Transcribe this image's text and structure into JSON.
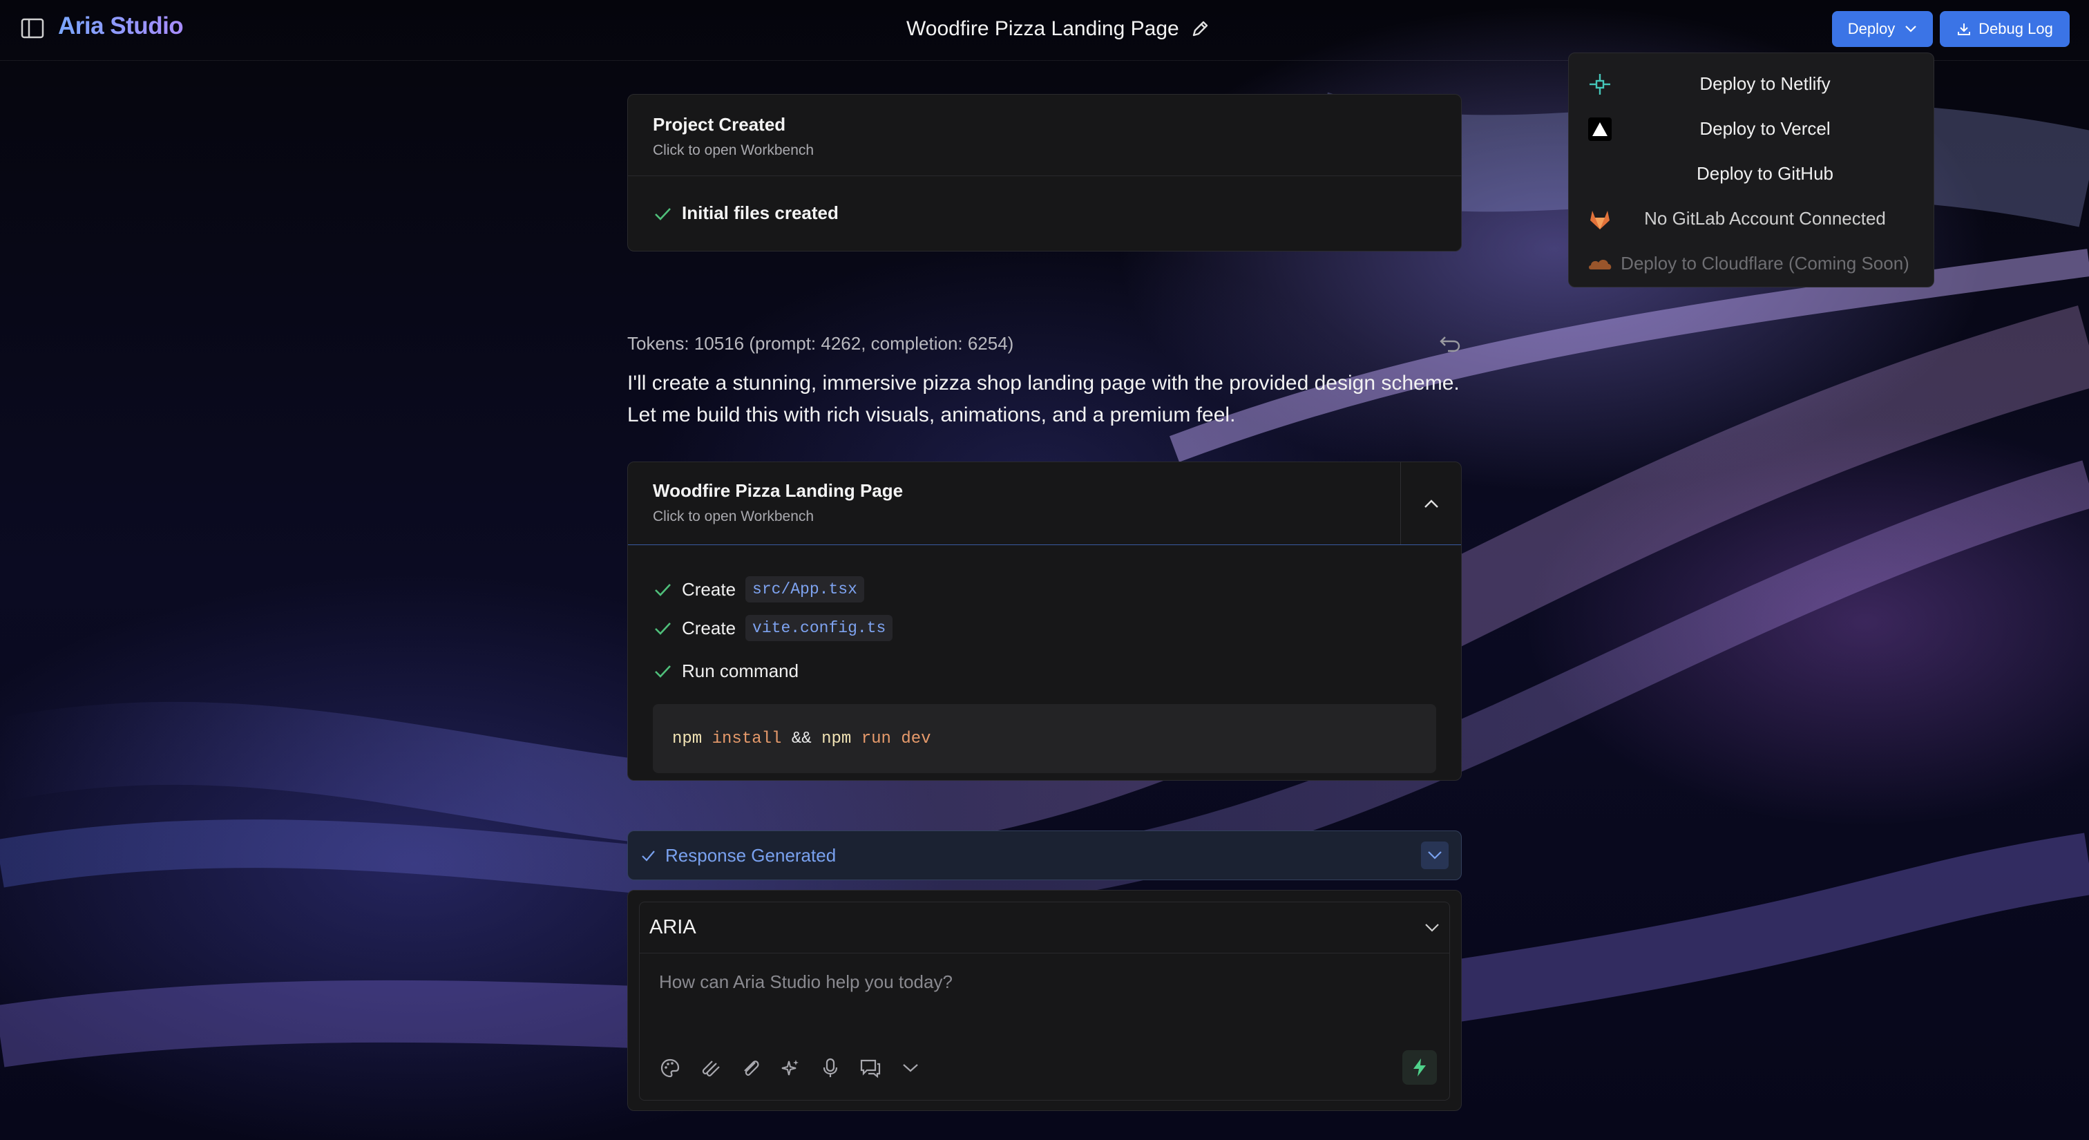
{
  "app": {
    "brand": "Aria Studio"
  },
  "header": {
    "project_title": "Woodfire Pizza Landing Page",
    "deploy_label": "Deploy",
    "debug_label": "Debug Log"
  },
  "deploy_menu": {
    "items": [
      {
        "label": "Deploy to Netlify",
        "icon": "netlify-icon"
      },
      {
        "label": "Deploy to Vercel",
        "icon": "vercel-icon"
      },
      {
        "label": "Deploy to GitHub",
        "icon": ""
      },
      {
        "label": "No GitLab Account Connected",
        "icon": "gitlab-icon"
      },
      {
        "label": "Deploy to Cloudflare (Coming Soon)",
        "icon": "cloudflare-icon"
      }
    ]
  },
  "card_project_created": {
    "title": "Project Created",
    "subtitle": "Click to open Workbench",
    "status": "Initial files created"
  },
  "tokens_text": "Tokens: 10516 (prompt: 4262, completion: 6254)",
  "assistant_message": "I'll create a stunning, immersive pizza shop landing page with the provided design scheme. Let me build this with rich visuals, animations, and a premium feel.",
  "card_artifact": {
    "title": "Woodfire Pizza Landing Page",
    "subtitle": "Click to open Workbench",
    "actions": [
      {
        "verb": "Create",
        "file": "src/App.tsx"
      },
      {
        "verb": "Create",
        "file": "vite.config.ts"
      },
      {
        "verb": "Run command",
        "file": ""
      }
    ],
    "command": {
      "parts": [
        "npm",
        "install",
        "&&",
        "npm",
        "run",
        "dev"
      ]
    }
  },
  "response_status": "Response Generated",
  "composer": {
    "model": "ARIA",
    "placeholder": "How can Aria Studio help you today?"
  },
  "colors": {
    "accent": "#3b74e6",
    "check": "#4fbf7a",
    "link": "#79a1ef"
  }
}
